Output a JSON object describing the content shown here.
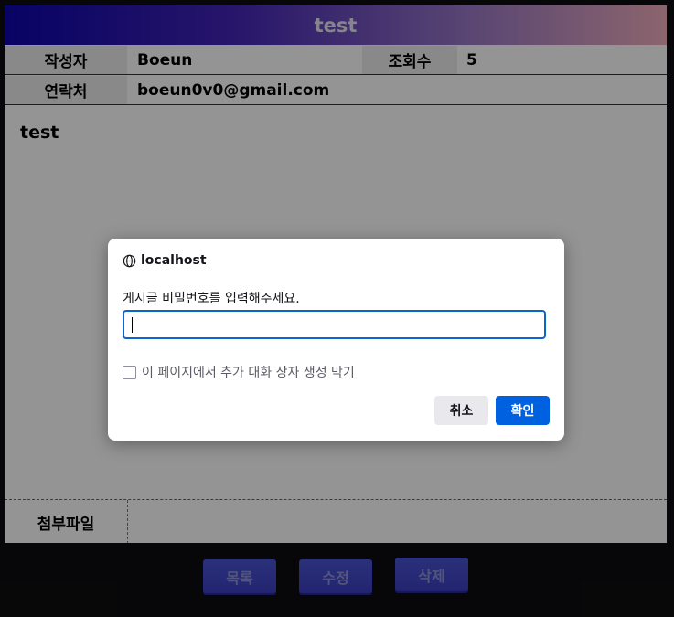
{
  "post": {
    "title": "test",
    "author_label": "작성자",
    "author_value": "Boeun",
    "views_label": "조회수",
    "views_value": "5",
    "contact_label": "연락처",
    "contact_value": "boeun0v0@gmail.com",
    "content": "test",
    "attachment_label": "첨부파일"
  },
  "actions": {
    "list_label": "목록",
    "edit_label": "수정",
    "delete_label": "삭제"
  },
  "dialog": {
    "host": "localhost",
    "message": "게시글 비밀번호를 입력해주세요.",
    "input_value": "",
    "suppress_label": "이 페이지에서 추가 대화 상자 생성 막기",
    "cancel_label": "취소",
    "ok_label": "확인"
  },
  "colors": {
    "accent": "#0061e0",
    "title_gradient_start": "#0d05ad",
    "title_gradient_end": "#f0aebd",
    "button": "#4a54d2"
  }
}
